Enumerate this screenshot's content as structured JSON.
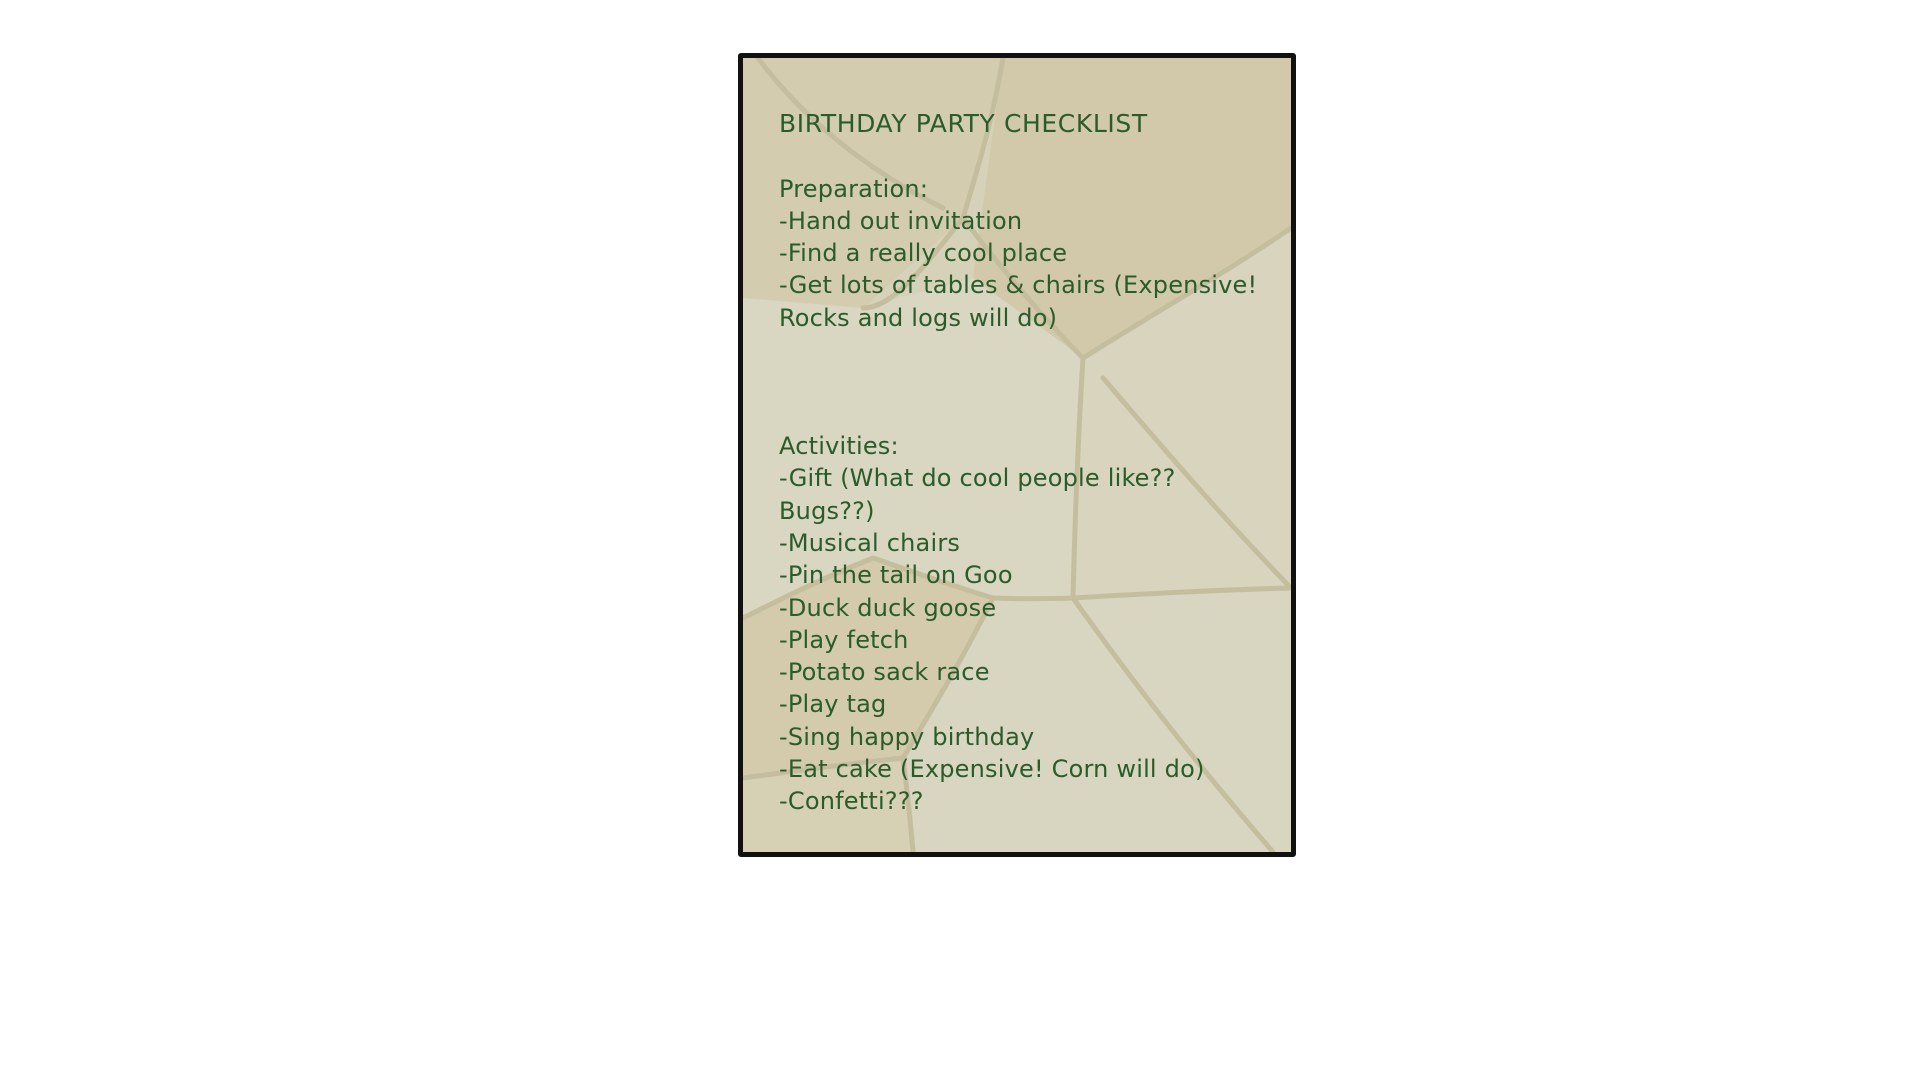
{
  "checklist": {
    "title": "BIRTHDAY PARTY CHECKLIST",
    "preparation": {
      "heading": "Preparation:",
      "lines": [
        "-Hand out invitation",
        "-Find a really cool place",
        "-Get lots of tables & chairs (Expensive!",
        "Rocks and logs will do)"
      ]
    },
    "activities": {
      "heading": "Activities:",
      "lines": [
        "-Gift (What do cool people like??",
        "Bugs??)",
        "-Musical chairs",
        "-Pin the tail on Goo",
        "-Duck duck goose",
        "-Play fetch",
        "-Potato sack race",
        "-Play tag",
        "-Sing happy birthday",
        "-Eat cake (Expensive! Corn will do)",
        "-Confetti???"
      ]
    }
  },
  "colors": {
    "text": "#2a5c2a",
    "paper": "#d6d2b9",
    "paper_dark": "#cfc7a4",
    "paper_light": "#dddbc6",
    "crack": "#c2bb9b",
    "border": "#111111",
    "background": "#ffffff"
  }
}
